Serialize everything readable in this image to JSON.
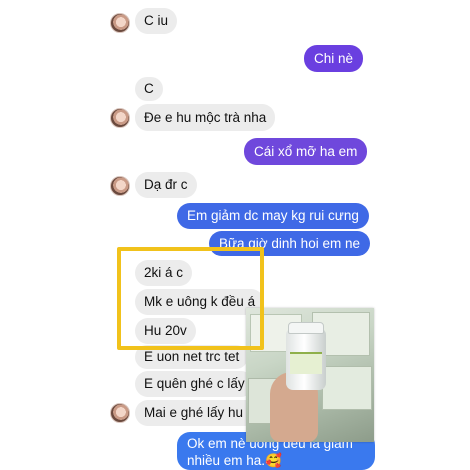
{
  "messages": [
    {
      "text": "C iu"
    },
    {
      "text": "Chi nè"
    },
    {
      "text": "C"
    },
    {
      "text": "Đe e hu mộc trà nha"
    },
    {
      "text": "Cái xổ mỡ ha em"
    },
    {
      "text": "Dạ đr c"
    },
    {
      "text": "Em giảm dc may kg rui cưng"
    },
    {
      "text": "Bữa giờ dinh hoi em ne"
    },
    {
      "text": "2ki á c"
    },
    {
      "text": "Mk e uông k đều á"
    },
    {
      "text": "Hu 20v"
    },
    {
      "text": "E uon net trc tet"
    },
    {
      "text": "E quên ghé c lấy"
    },
    {
      "text": "Mai e ghé lấy hu nu"
    },
    {
      "text": "Ok em nè uông đeu là giảm nhiều em ha.🥰"
    }
  ],
  "colors": {
    "incoming_bubble": "#ececec",
    "outgoing_purple": "#6a3fe0",
    "outgoing_blue": "#3f69e6",
    "highlight": "#f1c21b"
  },
  "icons": {
    "avatar": "contact-avatar",
    "photo": "product-jar-photo"
  }
}
